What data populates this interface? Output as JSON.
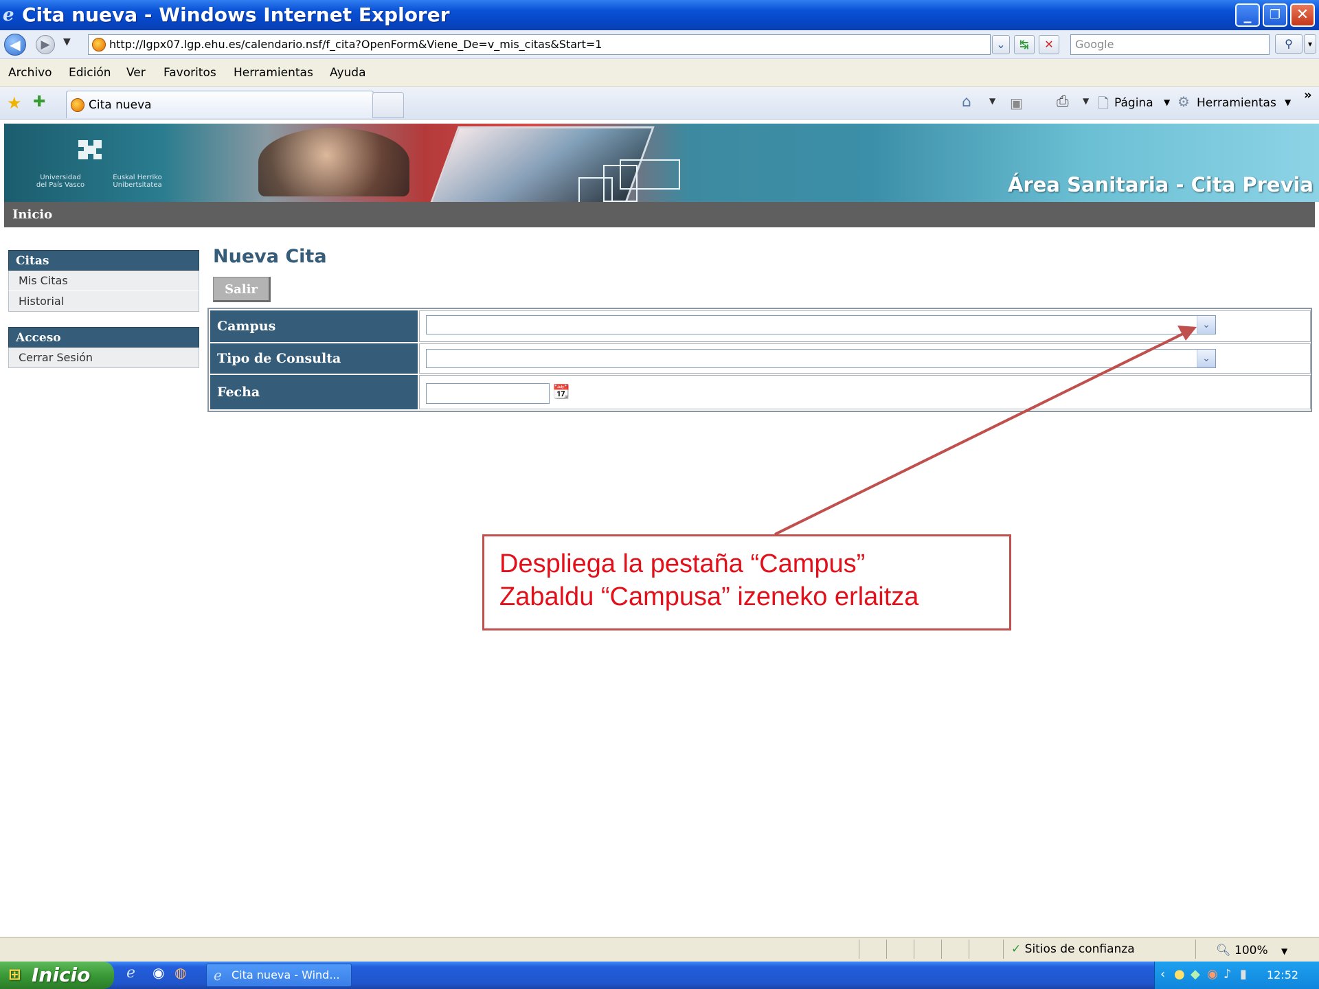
{
  "window": {
    "title": "Cita nueva - Windows Internet Explorer",
    "min_glyph": "_",
    "max_glyph": "❐",
    "close_glyph": "✕"
  },
  "address": {
    "url": "http://lgpx07.lgp.ehu.es/calendario.nsf/f_cita?OpenForm&Viene_De=v_mis_citas&Start=1",
    "search_placeholder": "Google"
  },
  "menu": [
    "Archivo",
    "Edición",
    "Ver",
    "Favoritos",
    "Herramientas",
    "Ayuda"
  ],
  "tab": {
    "label": "Cita nueva"
  },
  "command_bar": {
    "page_label": "Página",
    "tools_label": "Herramientas",
    "more_glyph": "»"
  },
  "banner": {
    "logo_left": "Universidad\ndel País Vasco",
    "logo_right": "Euskal Herriko\nUnibertsitatea",
    "title": "Área Sanitaria - Cita Previa"
  },
  "nav": {
    "home": "Inicio"
  },
  "sidebar": {
    "sections": [
      {
        "title": "Citas",
        "items": [
          "Mis Citas",
          "Historial"
        ]
      },
      {
        "title": "Acceso",
        "items": [
          "Cerrar Sesión"
        ]
      }
    ]
  },
  "form": {
    "title": "Nueva Cita",
    "exit_button": "Salir",
    "fields": [
      {
        "label": "Campus",
        "type": "select",
        "value": ""
      },
      {
        "label": "Tipo de Consulta",
        "type": "select",
        "value": ""
      },
      {
        "label": "Fecha",
        "type": "date",
        "value": ""
      }
    ]
  },
  "annotation": {
    "line1": "Despliega la pestaña “Campus”",
    "line2": "Zabaldu “Campusa” izeneko erlaitza",
    "color": "#e3101a",
    "border_color": "#c0504d"
  },
  "status": {
    "zone": "Sitios de confianza",
    "zoom": "100%"
  },
  "taskbar": {
    "start": "Inicio",
    "task": "Cita nueva - Wind...",
    "clock": "12:52"
  },
  "colors": {
    "sidebar_head": "#355c78",
    "nav_strip": "#5f5f5f",
    "title_blue": "#0645c4"
  }
}
